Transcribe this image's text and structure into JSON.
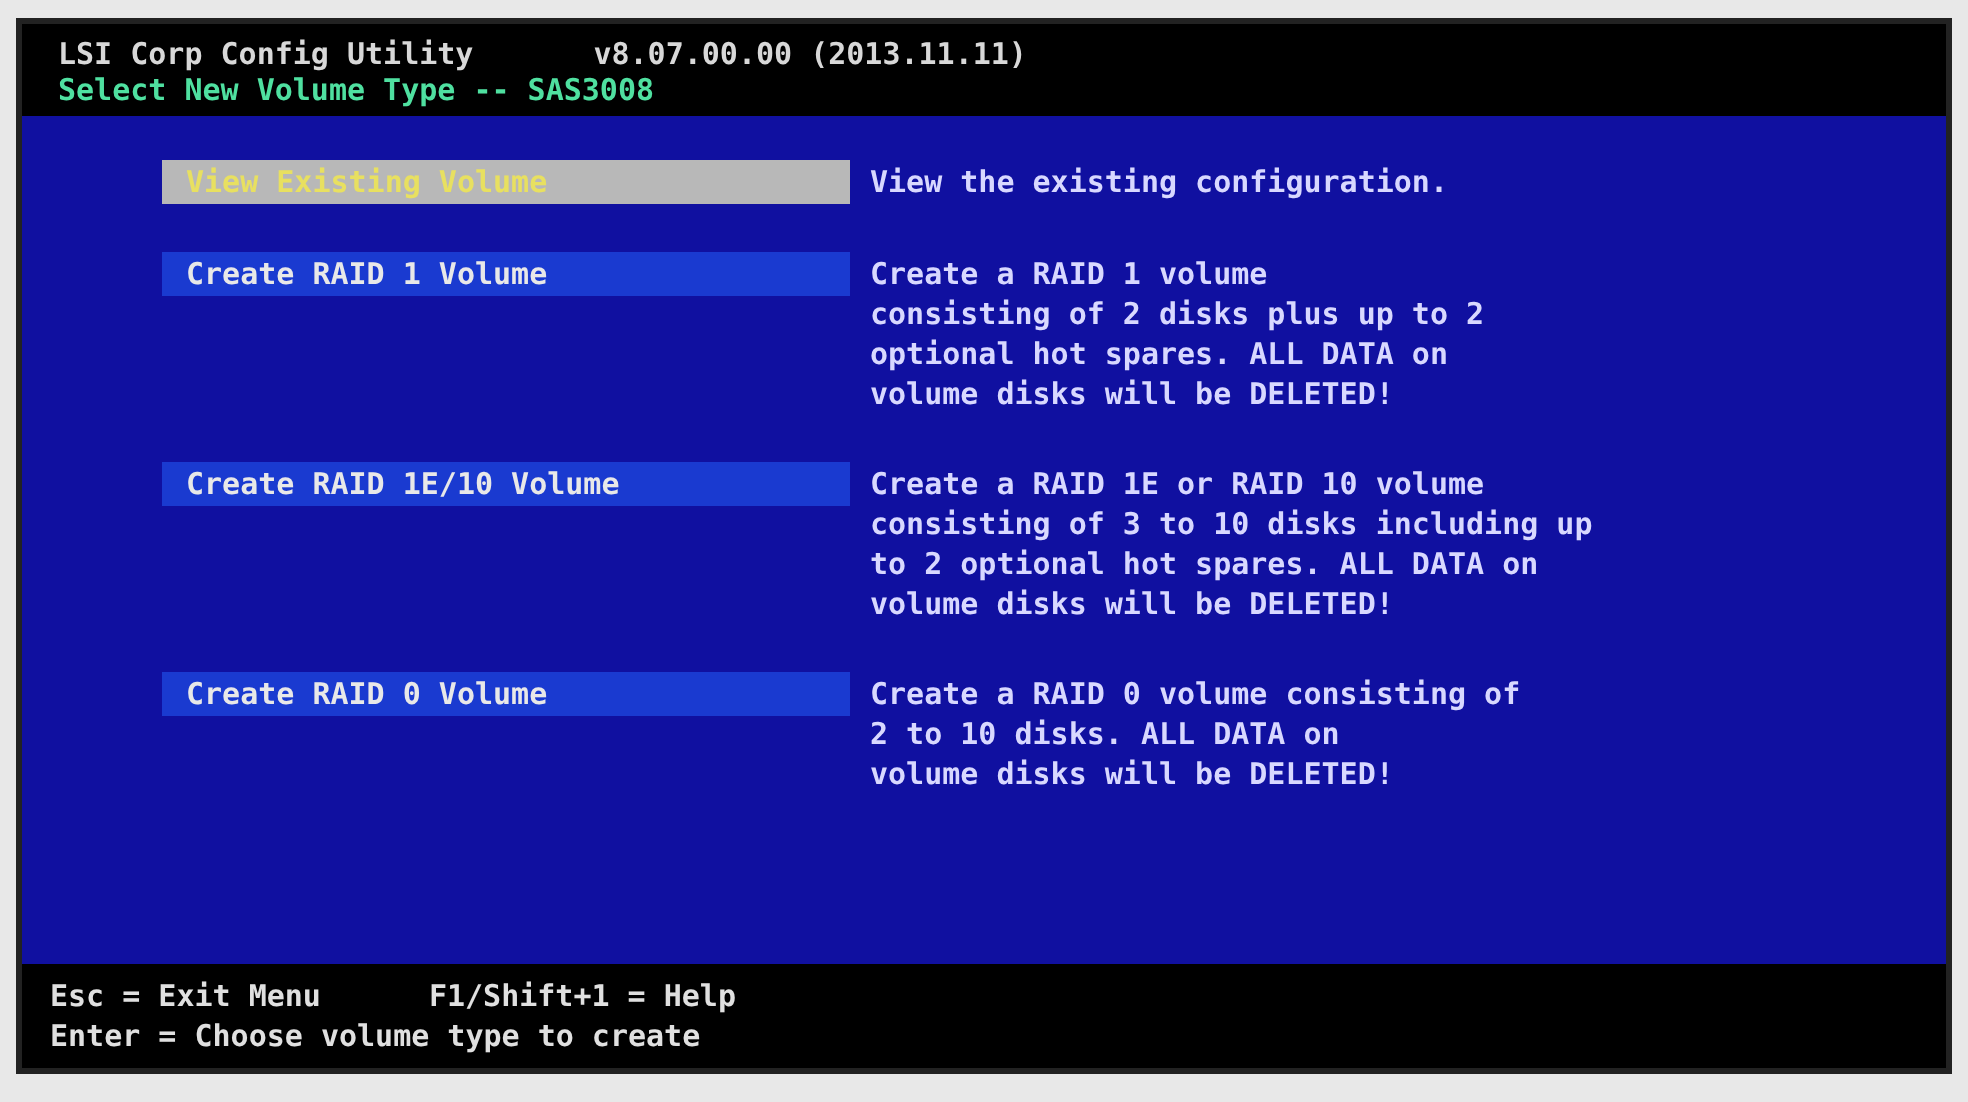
{
  "header": {
    "title": "LSI Corp Config Utility",
    "version": "v8.07.00.00 (2013.11.11)",
    "subtitle": "Select New Volume Type -- SAS3008"
  },
  "menu": [
    {
      "label": "View Existing Volume",
      "selected": true,
      "description": [
        "View the existing configuration."
      ]
    },
    {
      "label": "Create RAID 1 Volume",
      "selected": false,
      "description": [
        "Create a RAID 1 volume",
        "consisting of 2 disks plus up to 2",
        "optional hot spares. ALL DATA on",
        "volume disks will be DELETED!"
      ]
    },
    {
      "label": "Create RAID 1E/10 Volume",
      "selected": false,
      "description": [
        "Create a RAID 1E or RAID 10 volume",
        "consisting of 3 to 10 disks including up",
        "to 2 optional hot spares. ALL DATA on",
        "volume disks will be DELETED!"
      ]
    },
    {
      "label": "Create RAID 0 Volume",
      "selected": false,
      "description": [
        "Create a RAID 0 volume consisting of",
        "2 to 10 disks. ALL DATA on",
        "volume disks will be DELETED!"
      ]
    }
  ],
  "footer": [
    [
      "Esc = Exit Menu",
      "F1/Shift+1 = Help"
    ],
    [
      "Enter = Choose volume type to create"
    ]
  ]
}
